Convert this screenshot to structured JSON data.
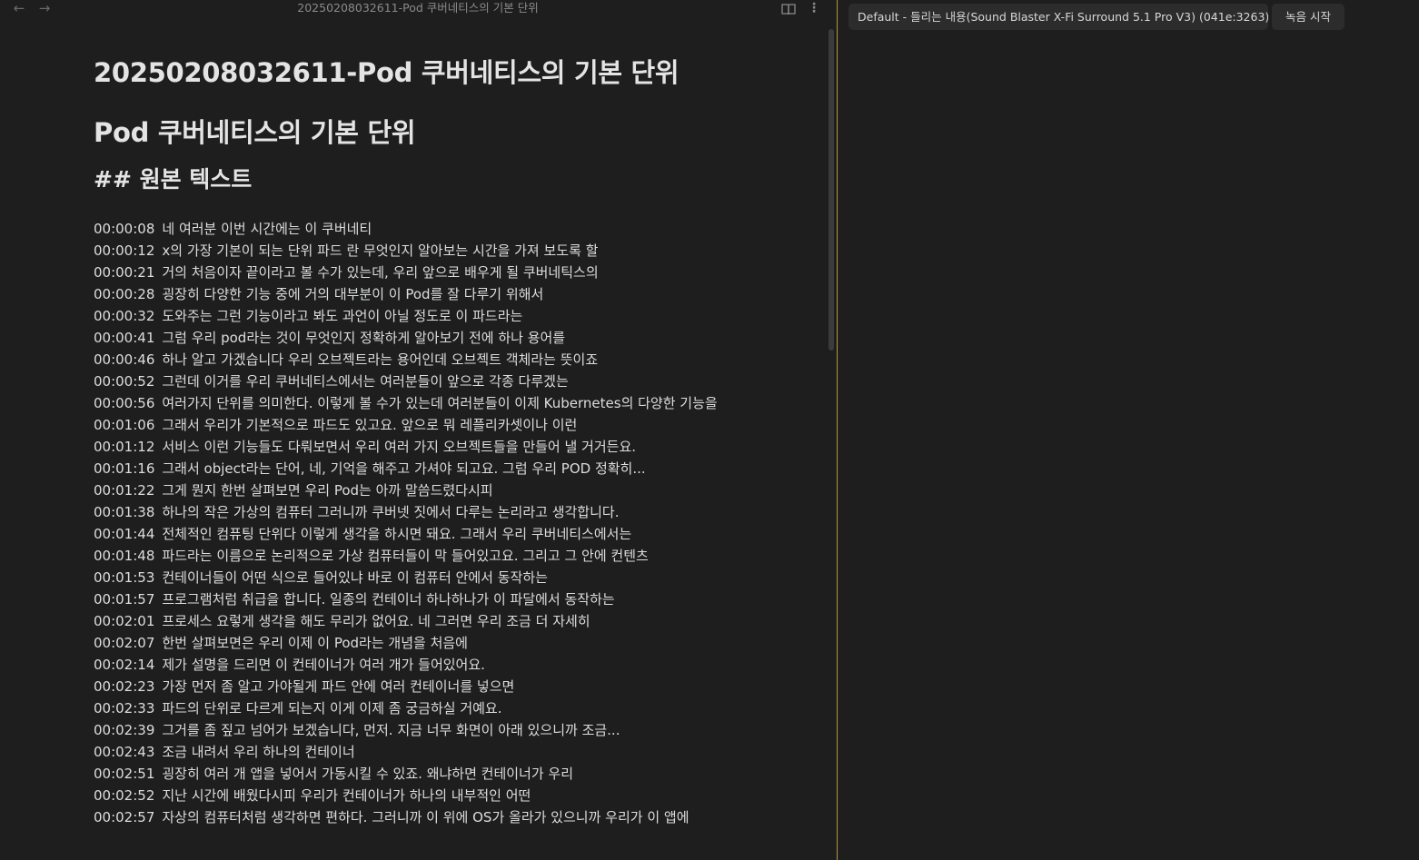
{
  "editor": {
    "tab_title": "20250208032611-Pod 쿠버네티스의 기본 단위",
    "nav_back_icon": "arrow-left-icon",
    "nav_forward_icon": "arrow-right-icon",
    "reading_mode_icon": "book-open-icon",
    "more_options_icon": "more-vertical-icon",
    "h1": "20250208032611-Pod 쿠버네티스의 기본 단위",
    "h2": "Pod 쿠버네티스의 기본 단위",
    "h3": "## 원본 텍스트",
    "transcript": [
      {
        "time": "00:00:08",
        "text": "네 여러분 이번 시간에는 이 쿠버네티"
      },
      {
        "time": "00:00:12",
        "text": "x의 가장 기본이 되는 단위 파드 란 무엇인지 알아보는 시간을 가져 보도록 할"
      },
      {
        "time": "00:00:21",
        "text": "거의 처음이자 끝이라고 볼 수가 있는데, 우리 앞으로 배우게 될 쿠버네틱스의"
      },
      {
        "time": "00:00:28",
        "text": "굉장히 다양한 기능 중에 거의 대부분이 이 Pod를 잘 다루기 위해서"
      },
      {
        "time": "00:00:32",
        "text": "도와주는 그런 기능이라고 봐도 과언이 아닐 정도로 이 파드라는"
      },
      {
        "time": "00:00:41",
        "text": "그럼 우리 pod라는 것이 무엇인지 정확하게 알아보기 전에 하나 용어를"
      },
      {
        "time": "00:00:46",
        "text": "하나 알고 가겠습니다 우리 오브젝트라는 용어인데 오브젝트 객체라는 뜻이죠"
      },
      {
        "time": "00:00:52",
        "text": "그런데 이거를 우리 쿠버네티스에서는 여러분들이 앞으로 각종 다루겠는"
      },
      {
        "time": "00:00:56",
        "text": "여러가지 단위를 의미한다. 이렇게 볼 수가 있는데 여러분들이 이제 Kubernetes의 다양한 기능을"
      },
      {
        "time": "00:01:06",
        "text": "그래서 우리가 기본적으로 파드도 있고요. 앞으로 뭐 레플리카셋이나 이런"
      },
      {
        "time": "00:01:12",
        "text": "서비스 이런 기능들도 다뤄보면서 우리 여러 가지 오브젝트들을 만들어 낼 거거든요."
      },
      {
        "time": "00:01:16",
        "text": "그래서 object라는 단어, 네, 기억을 해주고 가셔야 되고요. 그럼 우리 POD 정확히..."
      },
      {
        "time": "00:01:22",
        "text": "그게 뭔지 한번 살펴보면 우리 Pod는 아까 말씀드렸다시피"
      },
      {
        "time": "00:01:38",
        "text": "하나의 작은 가상의 컴퓨터 그러니까 쿠버넷 짓에서 다루는 논리라고 생각합니다."
      },
      {
        "time": "00:01:44",
        "text": "전체적인 컴퓨팅 단위다 이렇게 생각을 하시면 돼요. 그래서 우리 쿠버네티스에서는"
      },
      {
        "time": "00:01:48",
        "text": "파드라는 이름으로 논리적으로 가상 컴퓨터들이 막 들어있고요. 그리고 그 안에 컨텐츠"
      },
      {
        "time": "00:01:53",
        "text": "컨테이너들이 어떤 식으로 들어있냐 바로 이 컴퓨터 안에서 동작하는"
      },
      {
        "time": "00:01:57",
        "text": "프로그램처럼 취급을 합니다. 일종의 컨테이너 하나하나가 이 파달에서 동작하는"
      },
      {
        "time": "00:02:01",
        "text": "프로세스 요렇게 생각을 해도 무리가 없어요. 네 그러면 우리 조금 더 자세히"
      },
      {
        "time": "00:02:07",
        "text": "한번 살펴보면은 우리 이제 이 Pod라는 개념을 처음에"
      },
      {
        "time": "00:02:14",
        "text": "제가 설명을 드리면 이 컨테이너가 여러 개가 들어있어요."
      },
      {
        "time": "00:02:23",
        "text": "가장 먼저 좀 알고 가야될게 파드 안에 여러 컨테이너를 넣으면"
      },
      {
        "time": "00:02:33",
        "text": "파드의 단위로 다르게 되는지 이게 이제 좀 궁금하실 거예요."
      },
      {
        "time": "00:02:39",
        "text": "그거를 좀 짚고 넘어가 보겠습니다, 먼저. 지금 너무 화면이 아래 있으니까 조금..."
      },
      {
        "time": "00:02:43",
        "text": "조금 내려서 우리 하나의 컨테이너"
      },
      {
        "time": "00:02:51",
        "text": "굉장히 여러 개 앱을 넣어서 가동시킬 수 있죠. 왜냐하면 컨테이너가 우리"
      },
      {
        "time": "00:02:52",
        "text": "지난 시간에 배웠다시피 우리가 컨테이너가 하나의 내부적인 어떤"
      },
      {
        "time": "00:02:57",
        "text": "자상의 컴퓨터처럼 생각하면 편하다. 그러니까 이 위에 OS가 올라가 있으니까 우리가 이 앱에"
      }
    ]
  },
  "recorder": {
    "device_select_value": "Default - 들리는 내용(Sound Blaster X-Fi Surround 5.1 Pro V3) (041e:3263)",
    "record_button_label": "녹음 시작"
  },
  "colors": {
    "background": "#1e1e1e",
    "text": "#dcddde",
    "divider_accent": "#b8943f",
    "spellcheck_underline": "#e04040"
  }
}
